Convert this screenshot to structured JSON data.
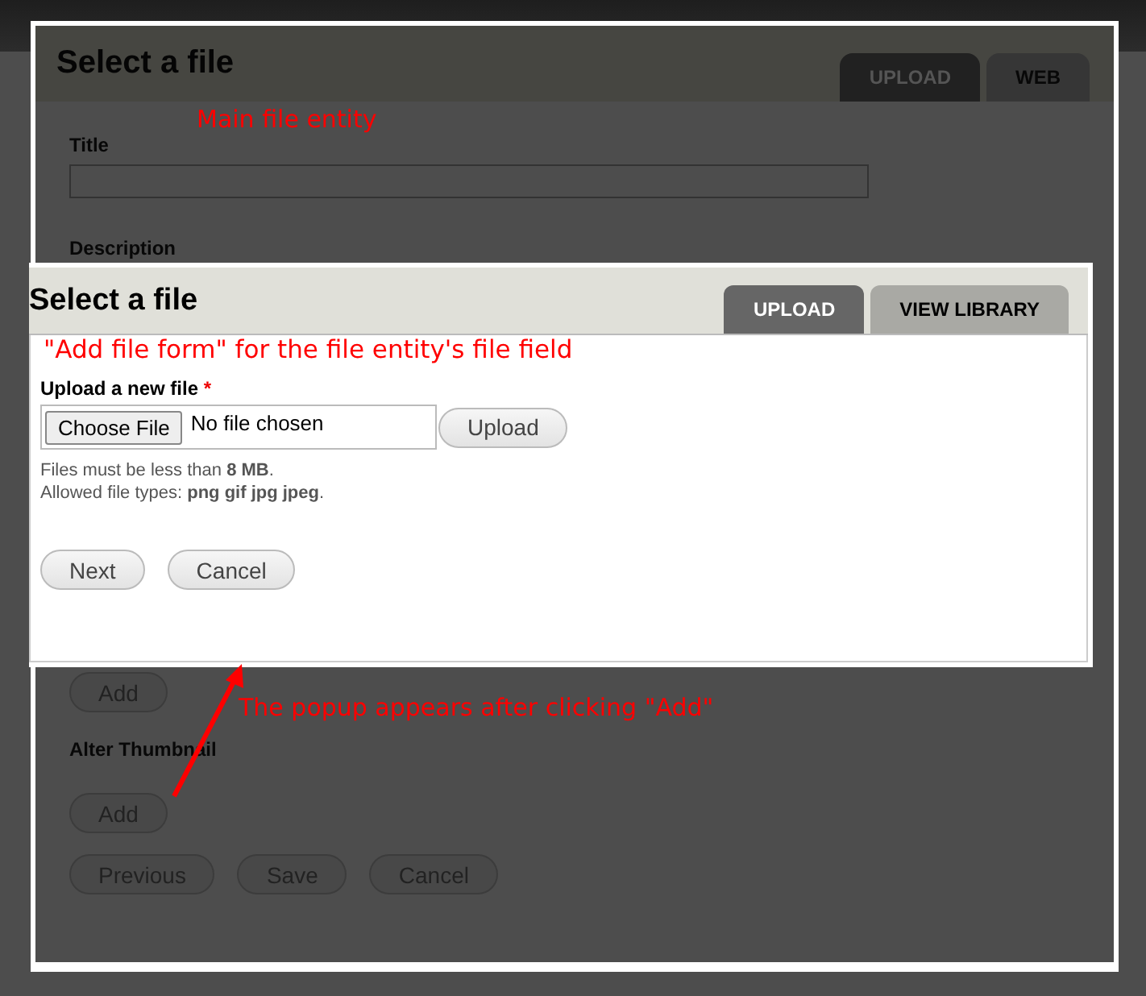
{
  "main_dialog": {
    "title": "Select a file",
    "tabs": [
      {
        "label": "UPLOAD",
        "selected": true
      },
      {
        "label": "WEB",
        "selected": false
      }
    ],
    "title_field": {
      "label": "Title"
    },
    "description_label": "Description",
    "add_button": "Add",
    "alter_thumbnail_label": "Alter Thumbnail",
    "thumbnail_add_button": "Add",
    "actions": [
      "Previous",
      "Save",
      "Cancel"
    ]
  },
  "popup": {
    "title": "Select a file",
    "tabs": [
      {
        "label": "UPLOAD",
        "selected": true
      },
      {
        "label": "VIEW LIBRARY",
        "selected": false
      }
    ],
    "upload_label": "Upload a new file",
    "required_mark": "*",
    "choose_button": "Choose File",
    "file_status": "No file chosen",
    "upload_button": "Upload",
    "help": [
      "Files must be less than **8 MB**.",
      "Allowed file types: **png gif jpg jpeg**."
    ],
    "actions": [
      "Next",
      "Cancel"
    ]
  },
  "annotations": {
    "main": "Main file entity",
    "popup": "\"Add file form\" for the file entity's file field",
    "arrow": "The popup appears after clicking \"Add\""
  }
}
